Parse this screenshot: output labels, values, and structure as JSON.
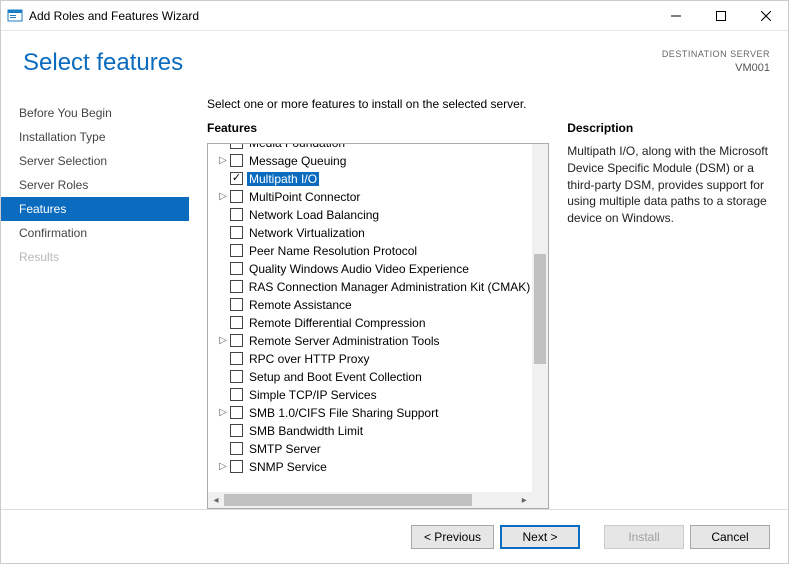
{
  "window": {
    "title": "Add Roles and Features Wizard"
  },
  "header": {
    "page_title": "Select features",
    "destination_label": "DESTINATION SERVER",
    "destination_value": "VM001"
  },
  "steps": [
    {
      "label": "Before You Begin",
      "state": "normal"
    },
    {
      "label": "Installation Type",
      "state": "normal"
    },
    {
      "label": "Server Selection",
      "state": "normal"
    },
    {
      "label": "Server Roles",
      "state": "normal"
    },
    {
      "label": "Features",
      "state": "active"
    },
    {
      "label": "Confirmation",
      "state": "normal"
    },
    {
      "label": "Results",
      "state": "disabled"
    }
  ],
  "main": {
    "intro": "Select one or more features to install on the selected server.",
    "features_label": "Features",
    "description_label": "Description",
    "description_text": "Multipath I/O, along with the Microsoft Device Specific Module (DSM) or a third-party DSM, provides support for using multiple data paths to a storage device on Windows.",
    "features": [
      {
        "label": "Media Foundation",
        "checked": false,
        "expandable": false,
        "selected": false
      },
      {
        "label": "Message Queuing",
        "checked": false,
        "expandable": true,
        "selected": false
      },
      {
        "label": "Multipath I/O",
        "checked": true,
        "expandable": false,
        "selected": true
      },
      {
        "label": "MultiPoint Connector",
        "checked": false,
        "expandable": true,
        "selected": false
      },
      {
        "label": "Network Load Balancing",
        "checked": false,
        "expandable": false,
        "selected": false
      },
      {
        "label": "Network Virtualization",
        "checked": false,
        "expandable": false,
        "selected": false
      },
      {
        "label": "Peer Name Resolution Protocol",
        "checked": false,
        "expandable": false,
        "selected": false
      },
      {
        "label": "Quality Windows Audio Video Experience",
        "checked": false,
        "expandable": false,
        "selected": false
      },
      {
        "label": "RAS Connection Manager Administration Kit (CMAK)",
        "checked": false,
        "expandable": false,
        "selected": false
      },
      {
        "label": "Remote Assistance",
        "checked": false,
        "expandable": false,
        "selected": false
      },
      {
        "label": "Remote Differential Compression",
        "checked": false,
        "expandable": false,
        "selected": false
      },
      {
        "label": "Remote Server Administration Tools",
        "checked": false,
        "expandable": true,
        "selected": false
      },
      {
        "label": "RPC over HTTP Proxy",
        "checked": false,
        "expandable": false,
        "selected": false
      },
      {
        "label": "Setup and Boot Event Collection",
        "checked": false,
        "expandable": false,
        "selected": false
      },
      {
        "label": "Simple TCP/IP Services",
        "checked": false,
        "expandable": false,
        "selected": false
      },
      {
        "label": "SMB 1.0/CIFS File Sharing Support",
        "checked": false,
        "expandable": true,
        "selected": false
      },
      {
        "label": "SMB Bandwidth Limit",
        "checked": false,
        "expandable": false,
        "selected": false
      },
      {
        "label": "SMTP Server",
        "checked": false,
        "expandable": false,
        "selected": false
      },
      {
        "label": "SNMP Service",
        "checked": false,
        "expandable": true,
        "selected": false
      }
    ]
  },
  "footer": {
    "previous": "< Previous",
    "next": "Next >",
    "install": "Install",
    "cancel": "Cancel"
  }
}
